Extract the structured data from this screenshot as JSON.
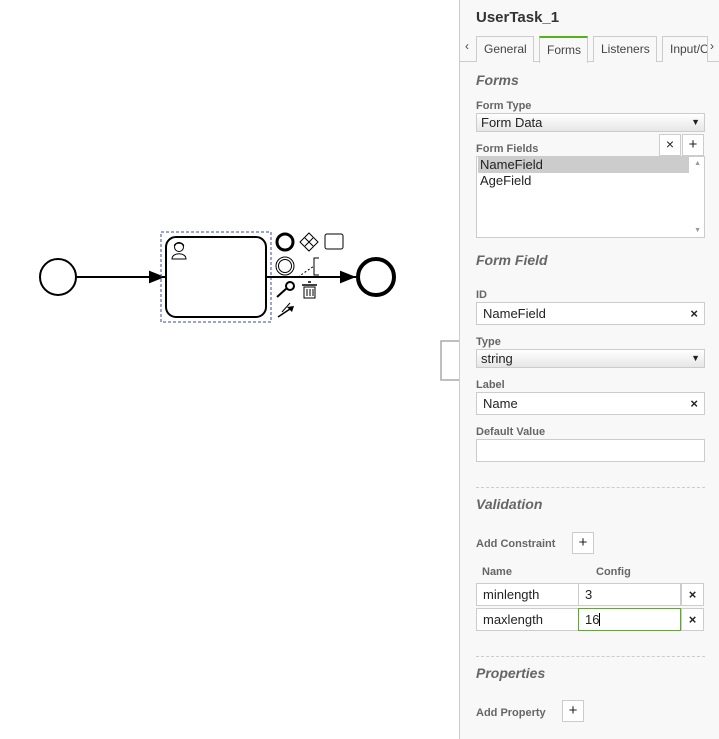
{
  "panel": {
    "title": "UserTask_1",
    "tabs": [
      {
        "label": "General"
      },
      {
        "label": "Forms"
      },
      {
        "label": "Listeners"
      },
      {
        "label": "Input/O"
      }
    ],
    "tab_prev": "‹",
    "tab_next": "›",
    "forms": {
      "section_title": "Forms",
      "form_type_label": "Form Type",
      "form_type_value": "Form Data",
      "form_fields_label": "Form Fields",
      "form_fields": [
        "NameField",
        "AgeField"
      ],
      "remove_label": "×",
      "add_label": "+"
    },
    "form_field": {
      "section_title": "Form Field",
      "id_label": "ID",
      "id_value": "NameField",
      "type_label": "Type",
      "type_value": "string",
      "label_label": "Label",
      "label_value": "Name",
      "default_label": "Default Value",
      "default_value": "",
      "clear_label": "×"
    },
    "validation": {
      "section_title": "Validation",
      "add_constraint_label": "Add Constraint",
      "add_label": "+",
      "col_name": "Name",
      "col_config": "Config",
      "rows": [
        {
          "name": "minlength",
          "config": "3"
        },
        {
          "name": "maxlength",
          "config": "16"
        }
      ],
      "remove_label": "×"
    },
    "properties": {
      "section_title": "Properties",
      "add_property_label": "Add Property",
      "add_label": "+"
    }
  },
  "colors": {
    "accent": "#52b415",
    "selection": "#cccccc",
    "dashed_selection": "#3a4a9c"
  },
  "icons": [
    "user-icon",
    "end-event-icon",
    "gateway-icon",
    "task-icon",
    "intermediate-event-icon",
    "text-annotation-icon",
    "wrench-icon",
    "trash-icon",
    "connect-arrow-icon"
  ]
}
